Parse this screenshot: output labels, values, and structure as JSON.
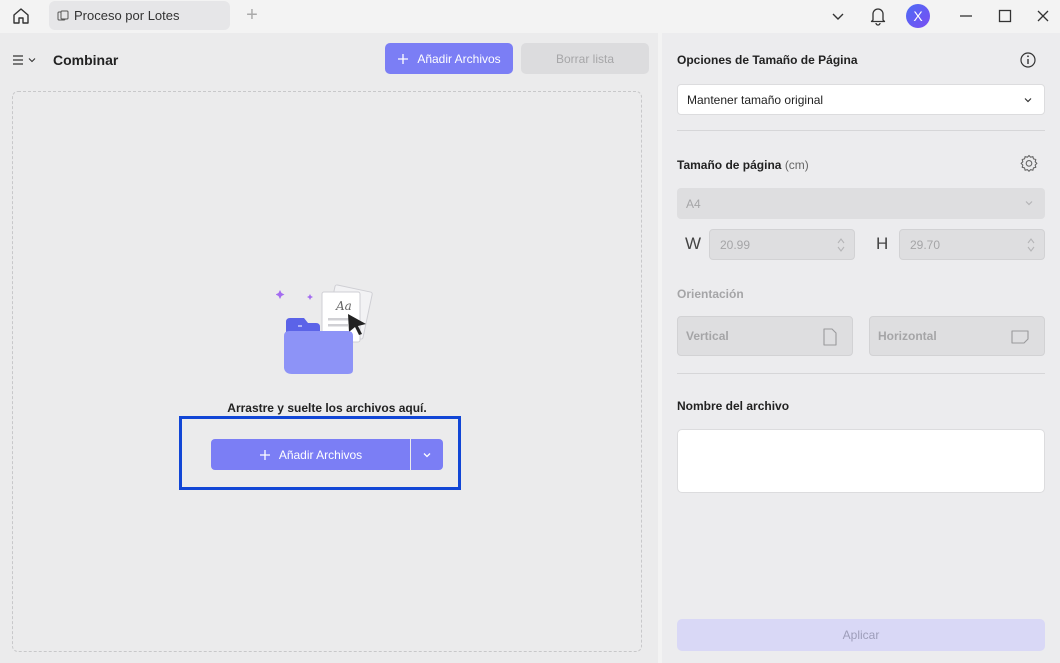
{
  "titlebar": {
    "tab_label": "Proceso por Lotes",
    "avatar_letter": "X",
    "icons": [
      "home-icon",
      "tab-doc-icon",
      "plus-icon",
      "chevron-down-icon",
      "bell-icon",
      "minimize-icon",
      "maximize-icon",
      "close-icon"
    ]
  },
  "left": {
    "title": "Combinar",
    "add_files_label": "Añadir Archivos",
    "clear_list_label": "Borrar lista",
    "drop_text": "Arrastre y suelte los archivos aquí.",
    "add_files_main_label": "Añadir Archivos"
  },
  "right": {
    "page_size_options_title": "Opciones de Tamaño de Página",
    "size_mode_selected": "Mantener tamaño original",
    "page_size_label": "Tamaño de página",
    "page_size_unit": "(cm)",
    "paper_selected": "A4",
    "width_label": "W",
    "width_value": "20.99",
    "height_label": "H",
    "height_value": "29.70",
    "orientation_label": "Orientación",
    "vertical_label": "Vertical",
    "horizontal_label": "Horizontal",
    "filename_label": "Nombre del archivo",
    "filename_value": "",
    "apply_label": "Aplicar"
  },
  "colors": {
    "accent": "#7b7ef5",
    "highlight": "#1146d6",
    "apply_disabled": "#d9d8f6"
  }
}
